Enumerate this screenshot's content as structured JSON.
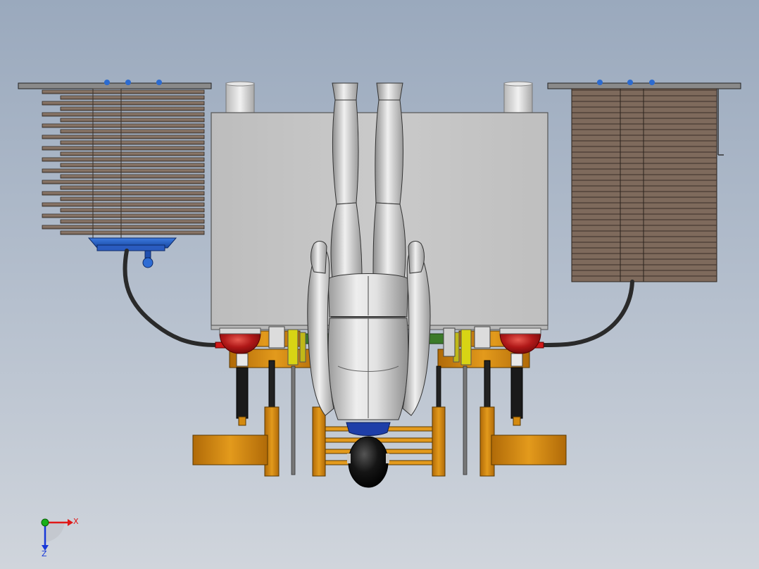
{
  "viewport": {
    "background_top": "#9aa9bd",
    "background_bottom": "#d0d5dc"
  },
  "model": {
    "colors": {
      "radiator_fins": "#8a7565",
      "radiator_plate": "#8c8c8c",
      "coolant_tank": "#2a62c4",
      "hose": "#3a3a3a",
      "panel": "#c6c6c6",
      "frame": "#d48a10",
      "red_dome": "#b21818",
      "figure": "#d8d8d8",
      "collar": "#1e3ea8",
      "hair": "#0b0b0b"
    }
  },
  "triad": {
    "x_label": "X",
    "z_label": "Z",
    "x_color": "#e01818",
    "y_color": "#18b018",
    "z_color": "#1838d8"
  }
}
